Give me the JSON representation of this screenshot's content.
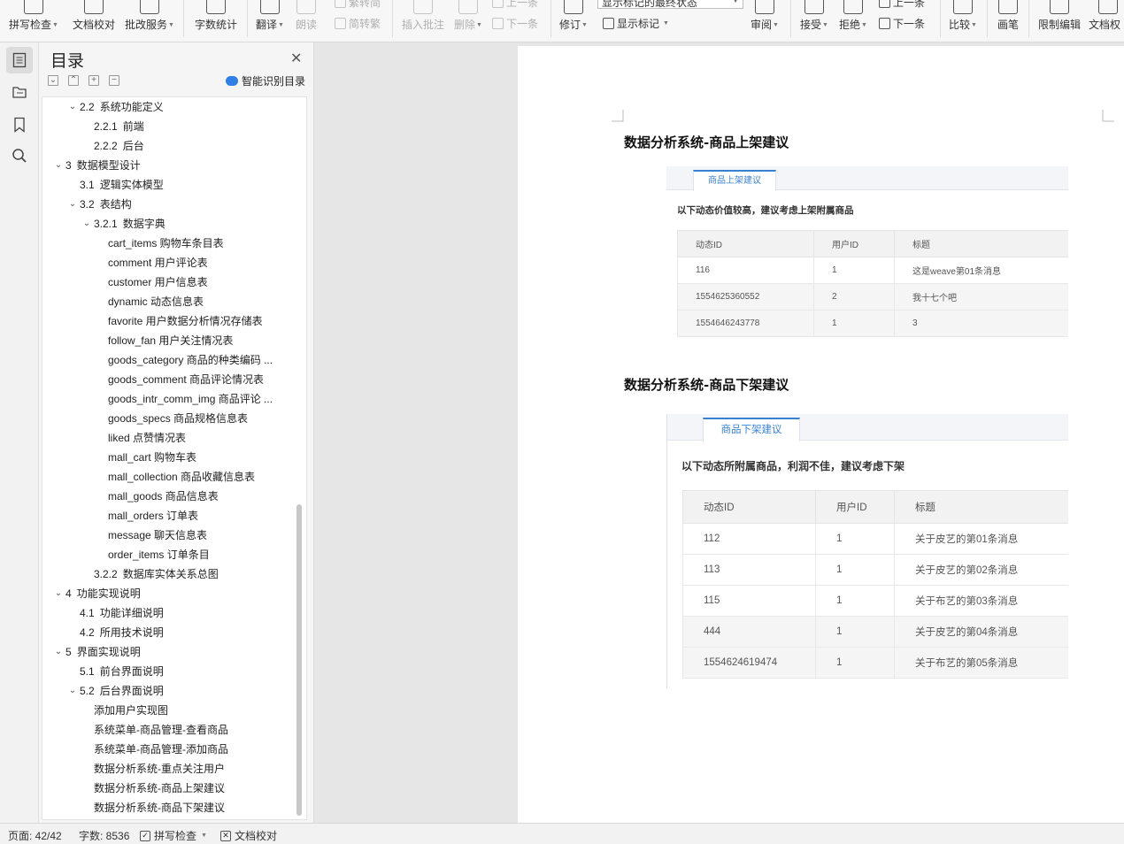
{
  "ribbon": {
    "spell_check": "拼写检查",
    "doc_proof": "文档校对",
    "batch_service": "批改服务",
    "word_count": "字数统计",
    "translate": "翻译",
    "read_aloud": "朗读",
    "trad_to_simp": "繁转简",
    "simp_to_trad": "简转繁",
    "insert_comment": "插入批注",
    "delete": "删除",
    "prev_item": "上一条",
    "next_item_disabled": "下一条",
    "revise": "修订",
    "markup_select_value": "显示标记的最终状态",
    "show_markup": "显示标记",
    "review": "审阅",
    "accept": "接受",
    "reject": "拒绝",
    "prev_change": "上一条",
    "next_change": "下一条",
    "compare": "比较",
    "pen": "画笔",
    "restrict_edit": "限制编辑",
    "doc_rights": "文档权"
  },
  "toc": {
    "title": "目录",
    "smart_label": "智能识别目录",
    "items": [
      {
        "num": "2.2",
        "text": "系统功能定义",
        "level": 2,
        "toggle": "expanded"
      },
      {
        "num": "2.2.1",
        "text": "前端",
        "level": 3,
        "toggle": "none"
      },
      {
        "num": "2.2.2",
        "text": "后台",
        "level": 3,
        "toggle": "none"
      },
      {
        "num": "3",
        "text": "数据模型设计",
        "level": 1,
        "toggle": "expanded"
      },
      {
        "num": "3.1",
        "text": "逻辑实体模型",
        "level": 2,
        "toggle": "none"
      },
      {
        "num": "3.2",
        "text": "表结构",
        "level": 2,
        "toggle": "expanded"
      },
      {
        "num": "3.2.1",
        "text": "数据字典",
        "level": 3,
        "toggle": "expanded"
      },
      {
        "num": "",
        "text": "cart_items 购物车条目表",
        "level": 4,
        "toggle": "none"
      },
      {
        "num": "",
        "text": "comment 用户评论表",
        "level": 4,
        "toggle": "none"
      },
      {
        "num": "",
        "text": "customer 用户信息表",
        "level": 4,
        "toggle": "none"
      },
      {
        "num": "",
        "text": "dynamic 动态信息表",
        "level": 4,
        "toggle": "none"
      },
      {
        "num": "",
        "text": "favorite 用户数据分析情况存储表",
        "level": 4,
        "toggle": "none"
      },
      {
        "num": "",
        "text": "follow_fan 用户关注情况表",
        "level": 4,
        "toggle": "none"
      },
      {
        "num": "",
        "text": "goods_category 商品的种类编码 ...",
        "level": 4,
        "toggle": "none"
      },
      {
        "num": "",
        "text": "goods_comment 商品评论情况表",
        "level": 4,
        "toggle": "none"
      },
      {
        "num": "",
        "text": "goods_intr_comm_img 商品评论 ...",
        "level": 4,
        "toggle": "none"
      },
      {
        "num": "",
        "text": "goods_specs 商品规格信息表",
        "level": 4,
        "toggle": "none"
      },
      {
        "num": "",
        "text": "liked 点赞情况表",
        "level": 4,
        "toggle": "none"
      },
      {
        "num": "",
        "text": "mall_cart 购物车表",
        "level": 4,
        "toggle": "none"
      },
      {
        "num": "",
        "text": "mall_collection 商品收藏信息表",
        "level": 4,
        "toggle": "none"
      },
      {
        "num": "",
        "text": "mall_goods 商品信息表",
        "level": 4,
        "toggle": "none"
      },
      {
        "num": "",
        "text": "mall_orders 订单表",
        "level": 4,
        "toggle": "none"
      },
      {
        "num": "",
        "text": "message 聊天信息表",
        "level": 4,
        "toggle": "none"
      },
      {
        "num": "",
        "text": "order_items 订单条目",
        "level": 4,
        "toggle": "none"
      },
      {
        "num": "3.2.2",
        "text": "数据库实体关系总图",
        "level": 3,
        "toggle": "none"
      },
      {
        "num": "4",
        "text": "功能实现说明",
        "level": 1,
        "toggle": "expanded"
      },
      {
        "num": "4.1",
        "text": "功能详细说明",
        "level": 2,
        "toggle": "none"
      },
      {
        "num": "4.2",
        "text": "所用技术说明",
        "level": 2,
        "toggle": "none"
      },
      {
        "num": "5",
        "text": "界面实现说明",
        "level": 1,
        "toggle": "expanded"
      },
      {
        "num": "5.1",
        "text": "前台界面说明",
        "level": 2,
        "toggle": "none"
      },
      {
        "num": "5.2",
        "text": "后台界面说明",
        "level": 2,
        "toggle": "expanded"
      },
      {
        "num": "",
        "text": "添加用户实现图",
        "level": 3,
        "toggle": "none"
      },
      {
        "num": "",
        "text": "系统菜单-商品管理-查看商品",
        "level": 3,
        "toggle": "none"
      },
      {
        "num": "",
        "text": "系统菜单-商品管理-添加商品",
        "level": 3,
        "toggle": "none"
      },
      {
        "num": "",
        "text": "数据分析系统-重点关注用户",
        "level": 3,
        "toggle": "none"
      },
      {
        "num": "",
        "text": "数据分析系统-商品上架建议",
        "level": 3,
        "toggle": "none"
      },
      {
        "num": "",
        "text": "数据分析系统-商品下架建议",
        "level": 3,
        "toggle": "none"
      }
    ]
  },
  "doc": {
    "section1": {
      "heading": "数据分析系统-商品上架建议",
      "tab": "商品上架建议",
      "subtitle": "以下动态价值较高，建议考虑上架附属商品",
      "columns": [
        "动态ID",
        "用户ID",
        "标题"
      ],
      "rows": [
        [
          "116",
          "1",
          "这是weave第01条消息"
        ],
        [
          "1554625360552",
          "2",
          "我十七个吧"
        ],
        [
          "1554646243778",
          "1",
          "3"
        ]
      ]
    },
    "section2": {
      "heading": "数据分析系统-商品下架建议",
      "tab": "商品下架建议",
      "subtitle": "以下动态所附属商品，利润不佳，建议考虑下架",
      "columns": [
        "动态ID",
        "用户ID",
        "标题"
      ],
      "rows": [
        [
          "112",
          "1",
          "关于皮艺的第01条消息"
        ],
        [
          "113",
          "1",
          "关于皮艺的第02条消息"
        ],
        [
          "115",
          "1",
          "关于布艺的第03条消息"
        ],
        [
          "444",
          "1",
          "关于皮艺的第04条消息"
        ],
        [
          "1554624619474",
          "1",
          "关于布艺的第05条消息"
        ]
      ]
    }
  },
  "status": {
    "page": "页面: 42/42",
    "words": "字数: 8536",
    "spell_check": "拼写检查",
    "doc_proof": "文档校对"
  }
}
